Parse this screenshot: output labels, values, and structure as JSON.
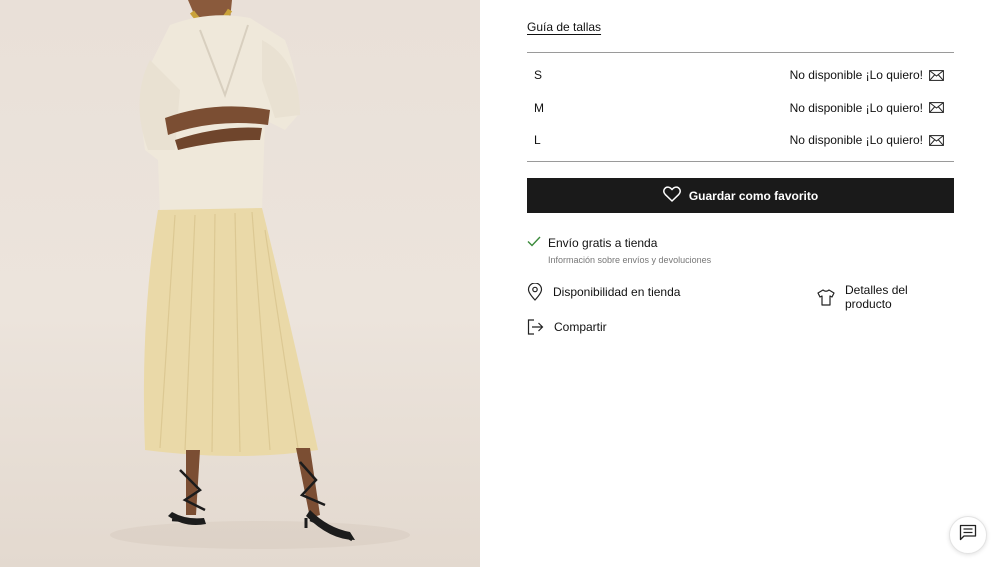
{
  "product_image": {
    "alt": ""
  },
  "size_guide_label": "Guía de tallas",
  "sizes": [
    {
      "size": "S",
      "status": "No disponible",
      "notify": "¡Lo quiero!"
    },
    {
      "size": "M",
      "status": "No disponible",
      "notify": "¡Lo quiero!"
    },
    {
      "size": "L",
      "status": "No disponible",
      "notify": "¡Lo quiero!"
    }
  ],
  "favorite_button": {
    "label": "Guardar como favorito"
  },
  "shipping": {
    "title": "Envío gratis a tienda",
    "info_link": "Información sobre envíos y devoluciones"
  },
  "links": {
    "store_availability": "Disponibilidad en tienda",
    "product_details": "Detalles del producto",
    "share": "Compartir"
  },
  "colors": {
    "primary_button": "#1a1a1a",
    "check": "#3a8a3a",
    "divider": "#9a9a9a"
  },
  "icons": [
    "mail-icon",
    "heart-icon",
    "check-icon",
    "location-pin-icon",
    "tshirt-icon",
    "share-icon",
    "chat-icon"
  ]
}
